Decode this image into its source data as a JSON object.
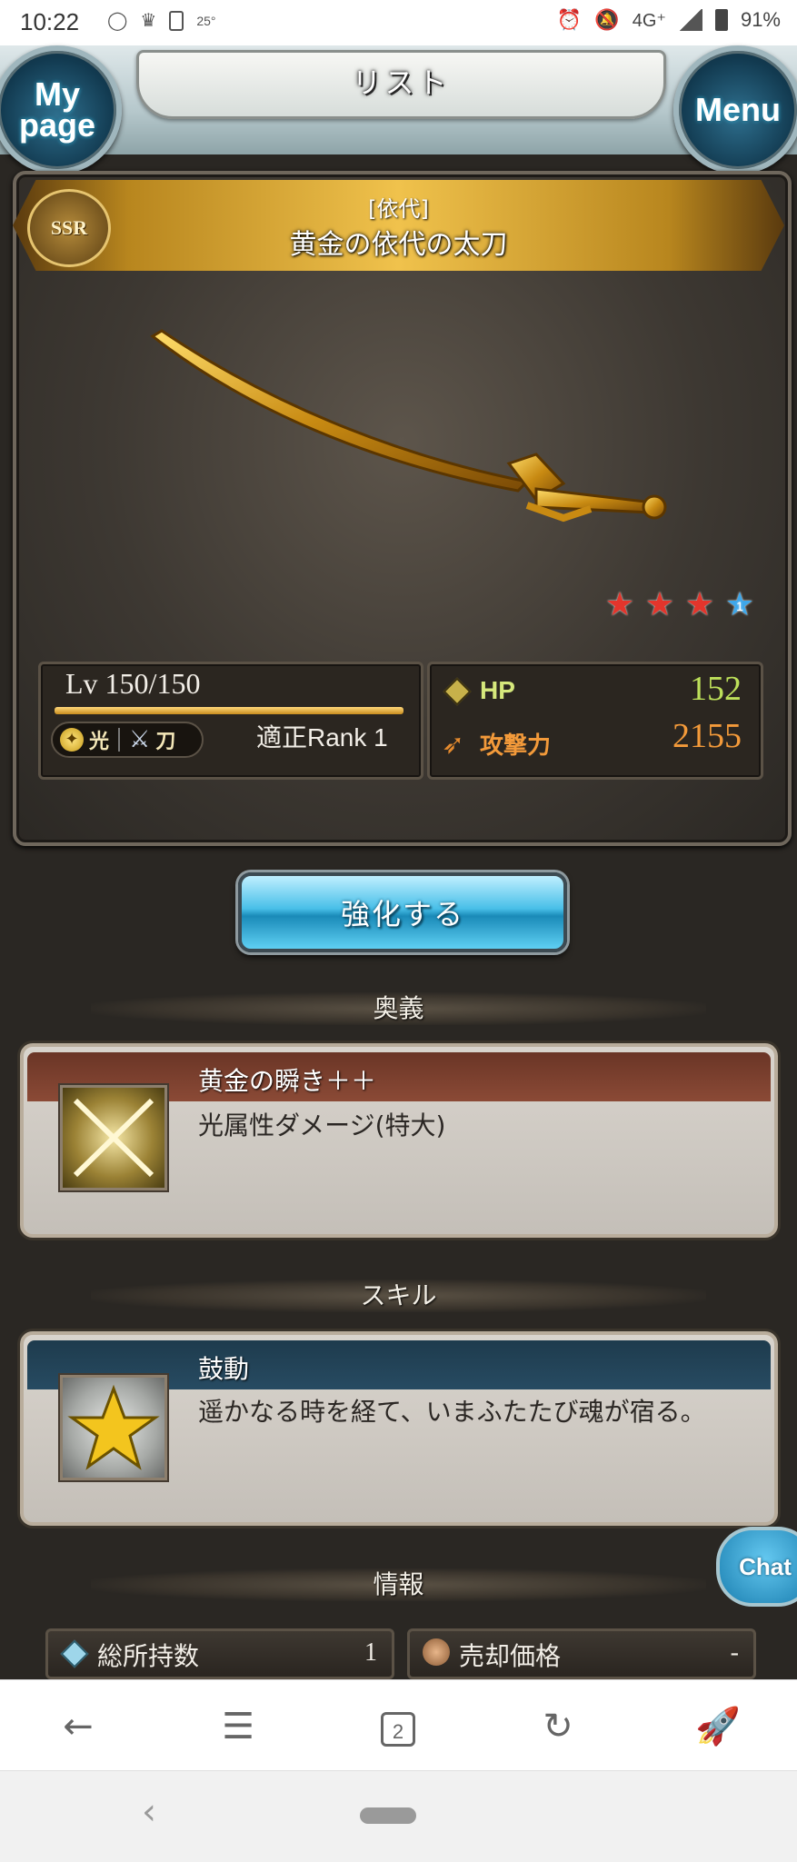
{
  "status_bar": {
    "time": "10:22",
    "temperature": "25°",
    "network": "4G⁺",
    "battery": "91%"
  },
  "header": {
    "title": "リスト",
    "mypage": "My page",
    "menu": "Menu"
  },
  "weapon": {
    "rarity": "SSR",
    "category": "[依代]",
    "name": "黄金の依代の太刀",
    "stars": {
      "red": 3,
      "blue": 1,
      "blue_label": "1"
    },
    "level": "Lv 150/150",
    "level_progress": 1.0,
    "element": "光",
    "weapon_type": "刀",
    "rank": "適正Rank 1",
    "hp_label": "HP",
    "hp": "152",
    "atk_label": "攻撃力",
    "atk": "2155"
  },
  "enhance_label": "強化する",
  "sections": {
    "ougi": "奥義",
    "skill": "スキル",
    "info": "情報"
  },
  "ougi": {
    "title": "黄金の瞬き＋＋",
    "desc": "光属性ダメージ(特大)"
  },
  "skill": {
    "title": "鼓動",
    "desc": "遥かなる時を経て、いまふたたび魂が宿る。"
  },
  "info": {
    "ownership_label": "総所持数",
    "ownership_value": "1",
    "sell_label": "売却価格",
    "sell_value": "-"
  },
  "chat_label": "Chat",
  "browser_bar": {
    "tab_count": "2"
  },
  "colors": {
    "hp": "#bde05a",
    "atk": "#f39a3a",
    "accent_blue": "#48bfe8",
    "gold": "#f0c24c"
  }
}
